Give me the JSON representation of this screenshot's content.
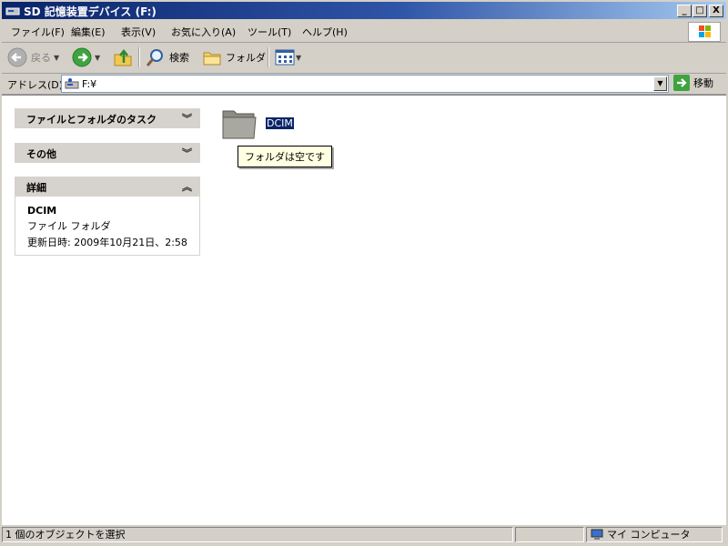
{
  "window": {
    "title": "SD 記憶装置デバイス (F:)",
    "minimize": "_",
    "maximize": "□",
    "close": "X"
  },
  "menu": {
    "items": [
      "ファイル(F)",
      "編集(E)",
      "表示(V)",
      "お気に入り(A)",
      "ツール(T)",
      "ヘルプ(H)"
    ]
  },
  "toolbar": {
    "back_label": "戻る",
    "search_label": "検索",
    "folders_label": "フォルダ"
  },
  "address": {
    "label": "アドレス(D)",
    "value": "F:¥",
    "go_label": "移動"
  },
  "sidebar": {
    "tasks_title": "ファイルとフォルダのタスク",
    "other_title": "その他",
    "details_title": "詳細",
    "details": {
      "name": "DCIM",
      "type": "ファイル フォルダ",
      "modified": "更新日時: 2009年10月21日、2:58"
    }
  },
  "main": {
    "folder_name": "DCIM",
    "tooltip": "フォルダは空です"
  },
  "status": {
    "selection": "1 個のオブジェクトを選択",
    "zone": "マイ コンピュータ"
  },
  "colors": {
    "title_start": "#0a246a",
    "selection": "#0a246a",
    "tooltip_bg": "#ffffe1",
    "chrome": "#d4d0c8"
  }
}
